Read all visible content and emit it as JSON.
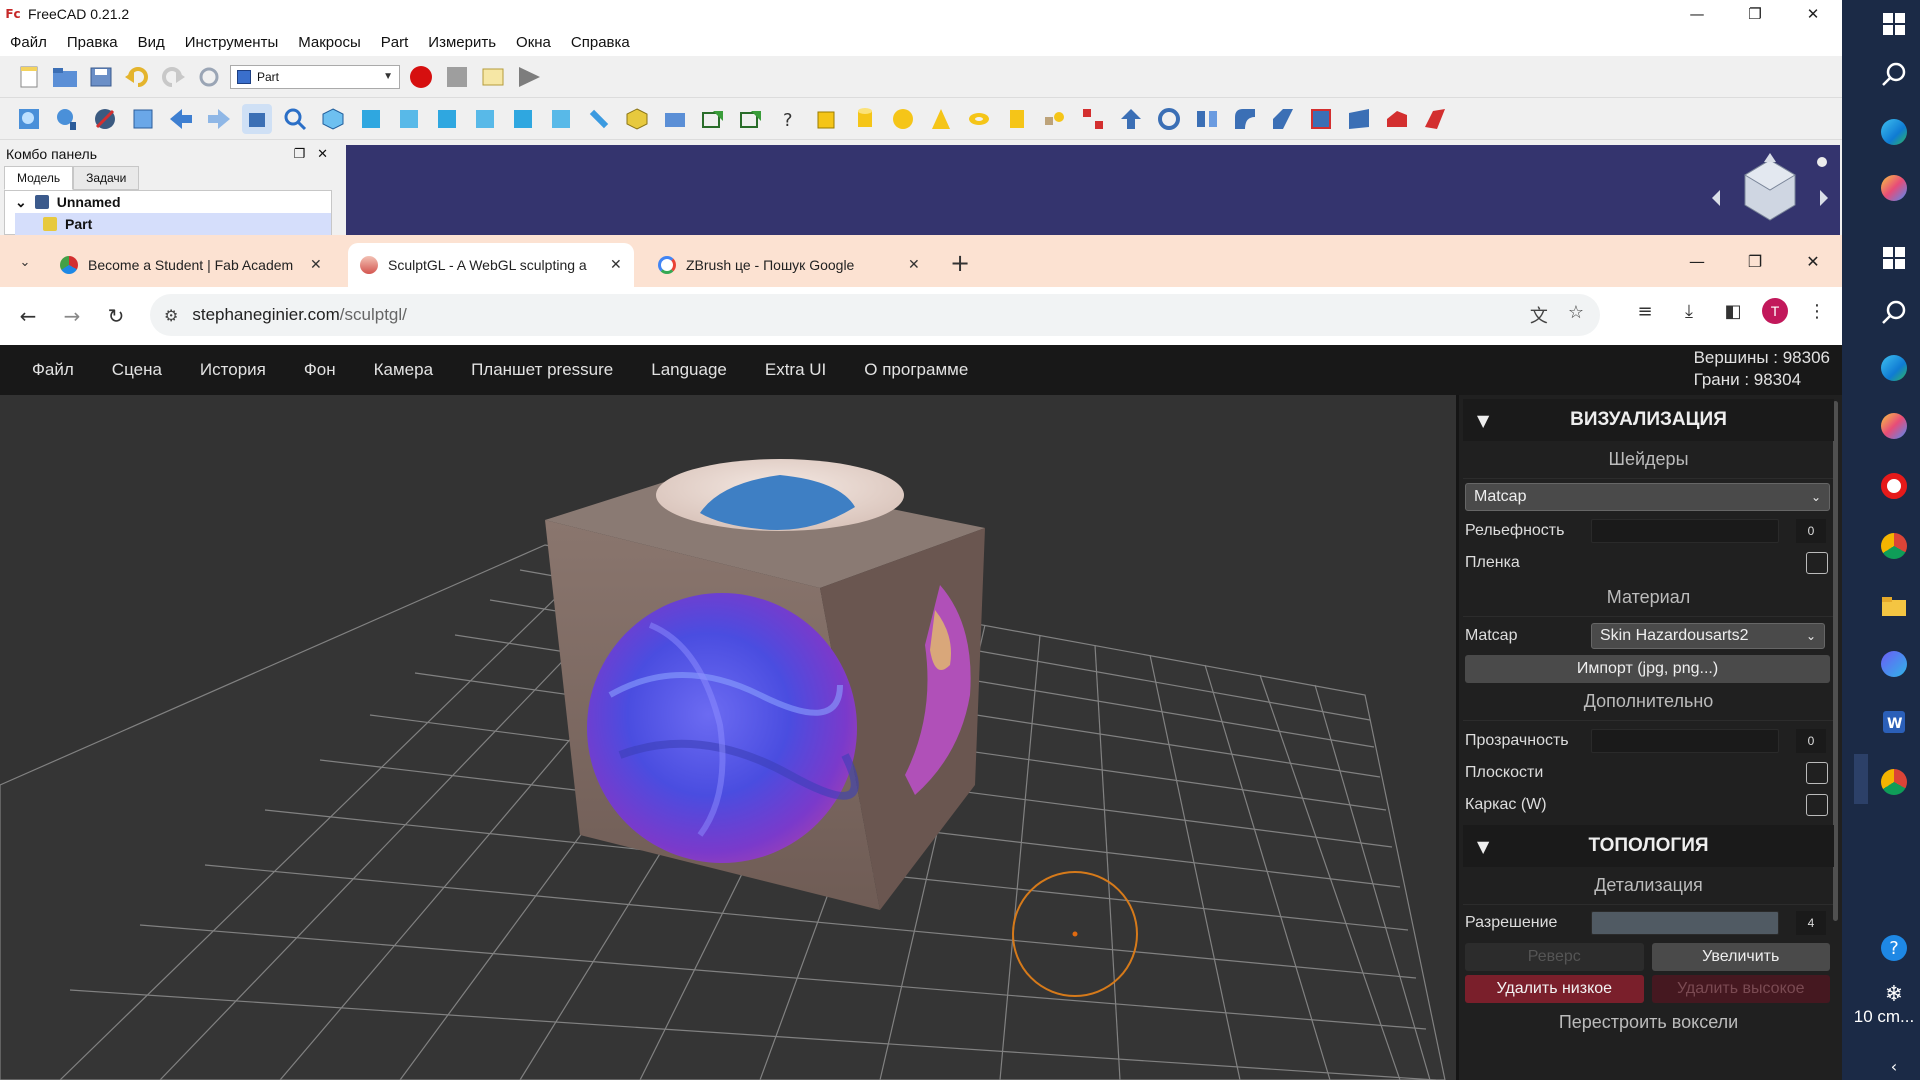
{
  "freecad": {
    "title": "FreeCAD 0.21.2",
    "menu": [
      "Файл",
      "Правка",
      "Вид",
      "Инструменты",
      "Макросы",
      "Part",
      "Измерить",
      "Окна",
      "Справка"
    ],
    "workbench": "Part",
    "combo_panel": {
      "title": "Комбо панель",
      "tabs": [
        "Модель",
        "Задачи"
      ],
      "tree": [
        "Unnamed",
        "Part"
      ]
    }
  },
  "chrome": {
    "tabs": [
      {
        "label": "Become a Student | Fab Academ",
        "favicon_color": "#d32f2f"
      },
      {
        "label": "SculptGL - A WebGL sculpting a",
        "favicon_color": "#e57373"
      },
      {
        "label": "ZBrush це - Пошук Google",
        "favicon_color": "#4285f4"
      }
    ],
    "url_host": "stephaneginier.com",
    "url_path": "/sculptgl/",
    "avatar_letter": "T"
  },
  "sculptgl": {
    "menu": [
      "Файл",
      "Сцена",
      "История",
      "Фон",
      "Камера",
      "Планшет pressure",
      "Language",
      "Extra UI",
      "О программе"
    ],
    "stats": {
      "vertices": "Вершины : 98306",
      "faces": "Грани : 98304"
    },
    "panel": {
      "viz_title": "ВИЗУАЛИЗАЦИЯ",
      "shaders_title": "Шейдеры",
      "shader_value": "Matcap",
      "relief_label": "Рельефность",
      "relief_value": "0",
      "film_label": "Пленка",
      "material_title": "Материал",
      "matcap_label": "Matcap",
      "matcap_value": "Skin Hazardousarts2",
      "import_label": "Импорт (jpg, png...)",
      "extra_title": "Дополнительно",
      "transparency_label": "Прозрачность",
      "transparency_value": "0",
      "planes_label": "Плоскости",
      "wireframe_label": "Каркас (W)",
      "topology_title": "ТОПОЛОГИЯ",
      "detail_title": "Детализация",
      "resolution_label": "Разрешение",
      "resolution_value": "4",
      "reverse_label": "Реверс",
      "increase_label": "Увеличить",
      "delete_low_label": "Удалить низкое",
      "delete_high_label": "Удалить высокое",
      "rebuild_voxels_label": "Перестроить воксели"
    }
  },
  "taskbar": {
    "clock": "10 cm..."
  }
}
